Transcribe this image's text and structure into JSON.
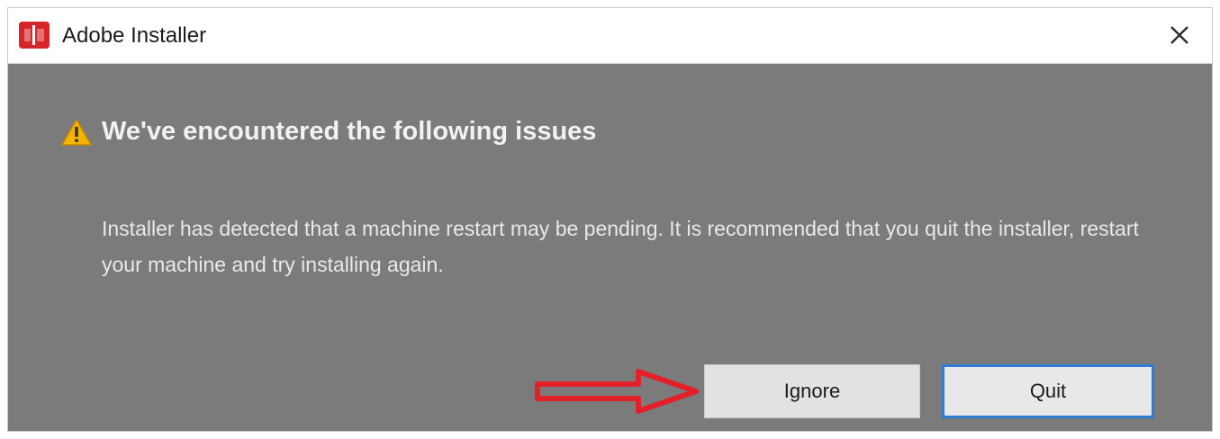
{
  "window": {
    "title": "Adobe Installer",
    "logo_icon": "adobe-logo-icon",
    "close_icon": "close-icon"
  },
  "dialog": {
    "warning_icon": "warning-icon",
    "heading": "We've encountered the following issues",
    "message": "Installer has detected that a machine restart may be pending. It is recommended that you quit the installer, restart your machine and try installing again."
  },
  "buttons": {
    "ignore_label": "Ignore",
    "quit_label": "Quit"
  },
  "annotation": {
    "arrow_icon": "red-arrow-icon",
    "arrow_color": "#e3202a"
  },
  "colors": {
    "dialog_background": "#7b7b7b",
    "brand": "#d7262a",
    "focus_border": "#2f7bd6"
  }
}
